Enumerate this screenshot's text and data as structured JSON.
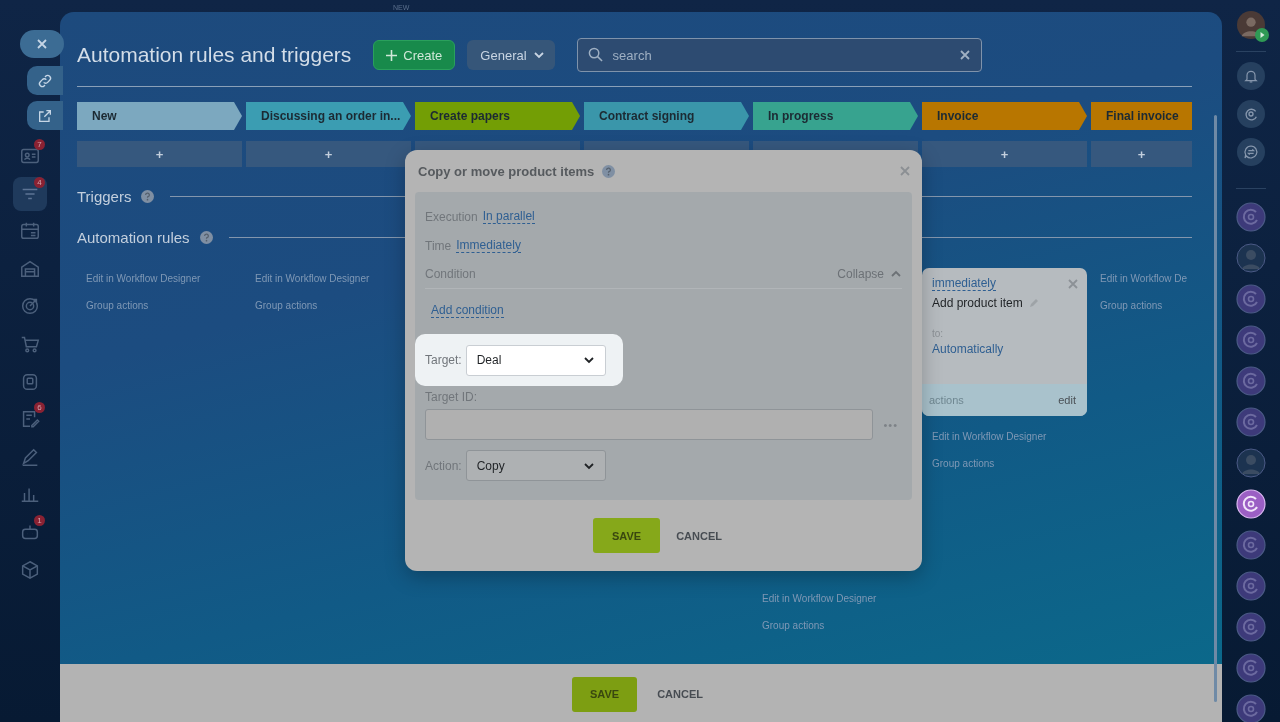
{
  "top_badge": "NEW",
  "sidebar": {
    "items": [
      {
        "selected": false,
        "badge": "7"
      },
      {
        "selected": true,
        "badge": "4"
      },
      {
        "selected": false
      },
      {
        "selected": false
      },
      {
        "selected": false
      },
      {
        "selected": false
      },
      {
        "selected": false
      },
      {
        "selected": false,
        "badge": "6"
      },
      {
        "selected": false
      },
      {
        "selected": false
      },
      {
        "selected": false,
        "badge": "1"
      },
      {
        "selected": false
      }
    ]
  },
  "header": {
    "title": "Automation rules and triggers",
    "create_button": "Create",
    "filter_button": "General",
    "search": {
      "placeholder": "search"
    }
  },
  "stages": [
    {
      "label": "New",
      "color": "#7ca8bf",
      "add": "+"
    },
    {
      "label": "Discussing an order in...",
      "color": "#3b9db2",
      "add": "+"
    },
    {
      "label": "Create papers",
      "color": "#739e05"
    },
    {
      "label": "Contract signing",
      "color": "#3a96aa"
    },
    {
      "label": "In progress",
      "color": "#37a38f"
    },
    {
      "label": "Invoice",
      "color": "#b87600",
      "add": "+"
    },
    {
      "label": "Final invoice",
      "color": "#b87600",
      "add": "+"
    }
  ],
  "sections": [
    {
      "title": "Triggers"
    },
    {
      "title": "Automation rules"
    }
  ],
  "rule_columns": [
    {
      "kind": "plain",
      "links": [
        "Edit in Workflow Designer",
        "Group actions"
      ]
    },
    {
      "kind": "plain",
      "links": [
        "Edit in Workflow Designer",
        "Group actions"
      ]
    },
    {
      "kind": "hidden"
    },
    {
      "kind": "hidden"
    },
    {
      "kind": "covered",
      "links": [
        "Edit in Workflow Designer",
        "Group actions"
      ]
    },
    {
      "kind": "card",
      "card": {
        "time": "immediately",
        "title": "Add product item",
        "to_label": "to:",
        "to_value": "Automatically",
        "footer_left": "actions",
        "footer_right": "edit"
      },
      "links": [
        "Edit in Workflow Designer",
        "Group actions"
      ]
    },
    {
      "kind": "plain",
      "links": [
        "Edit in Workflow De",
        "Group actions"
      ]
    }
  ],
  "dialog": {
    "title": "Copy or move product items",
    "fields": [
      {
        "label": "Execution",
        "value": "In parallel"
      },
      {
        "label": "Time",
        "value": "Immediately"
      }
    ],
    "condition": {
      "label": "Condition",
      "toggle": "Collapse",
      "expanded": true
    },
    "add_condition": "Add condition",
    "target": {
      "label": "Target:",
      "value": "Deal",
      "highlighted": true
    },
    "target_id": {
      "label": "Target ID:",
      "more": "•••"
    },
    "action": {
      "label": "Action:",
      "value": "Copy"
    },
    "save": "SAVE",
    "cancel": "CANCEL"
  },
  "footer": {
    "save": "SAVE",
    "cancel": "CANCEL"
  },
  "right_rail": {
    "items": [
      {
        "kind": "channel",
        "selected": false
      },
      {
        "kind": "person",
        "selected": false
      },
      {
        "kind": "channel",
        "selected": false
      },
      {
        "kind": "channel",
        "selected": false
      },
      {
        "kind": "channel",
        "selected": false
      },
      {
        "kind": "channel",
        "selected": false
      },
      {
        "kind": "person",
        "selected": false
      },
      {
        "kind": "channel",
        "selected": true
      },
      {
        "kind": "channel",
        "selected": false
      },
      {
        "kind": "channel",
        "selected": false
      },
      {
        "kind": "channel",
        "selected": false
      },
      {
        "kind": "channel",
        "selected": false
      },
      {
        "kind": "channel",
        "selected": false
      }
    ]
  }
}
